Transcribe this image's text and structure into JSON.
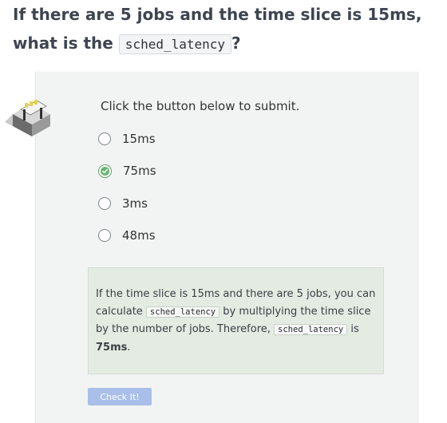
{
  "question": {
    "text_before": "If there are 5 jobs and the time slice is 15ms, what is the ",
    "code": "sched_latency",
    "text_after": "?"
  },
  "quiz": {
    "instruction": "Click the button below to submit.",
    "options": [
      {
        "label": "15ms",
        "selected": false
      },
      {
        "label": "75ms",
        "selected": true
      },
      {
        "label": "3ms",
        "selected": false
      },
      {
        "label": "48ms",
        "selected": false
      }
    ],
    "explanation": {
      "part1": "If the time slice is 15ms and there are 5 jobs, you can calculate ",
      "code1": "sched_latency",
      "part2": " by multiplying the time slice by the number of jobs. Therefore, ",
      "code2": "sched_latency",
      "part3": " is ",
      "answer": "75ms",
      "part4": "."
    },
    "submit_label": "Check It!"
  },
  "colors": {
    "selected_accent": "#67b373",
    "button_bg": "#a9bfe9",
    "explanation_bg": "#e3ebe2"
  },
  "icons": {
    "quiz_icon": "quiz-board-icon"
  }
}
